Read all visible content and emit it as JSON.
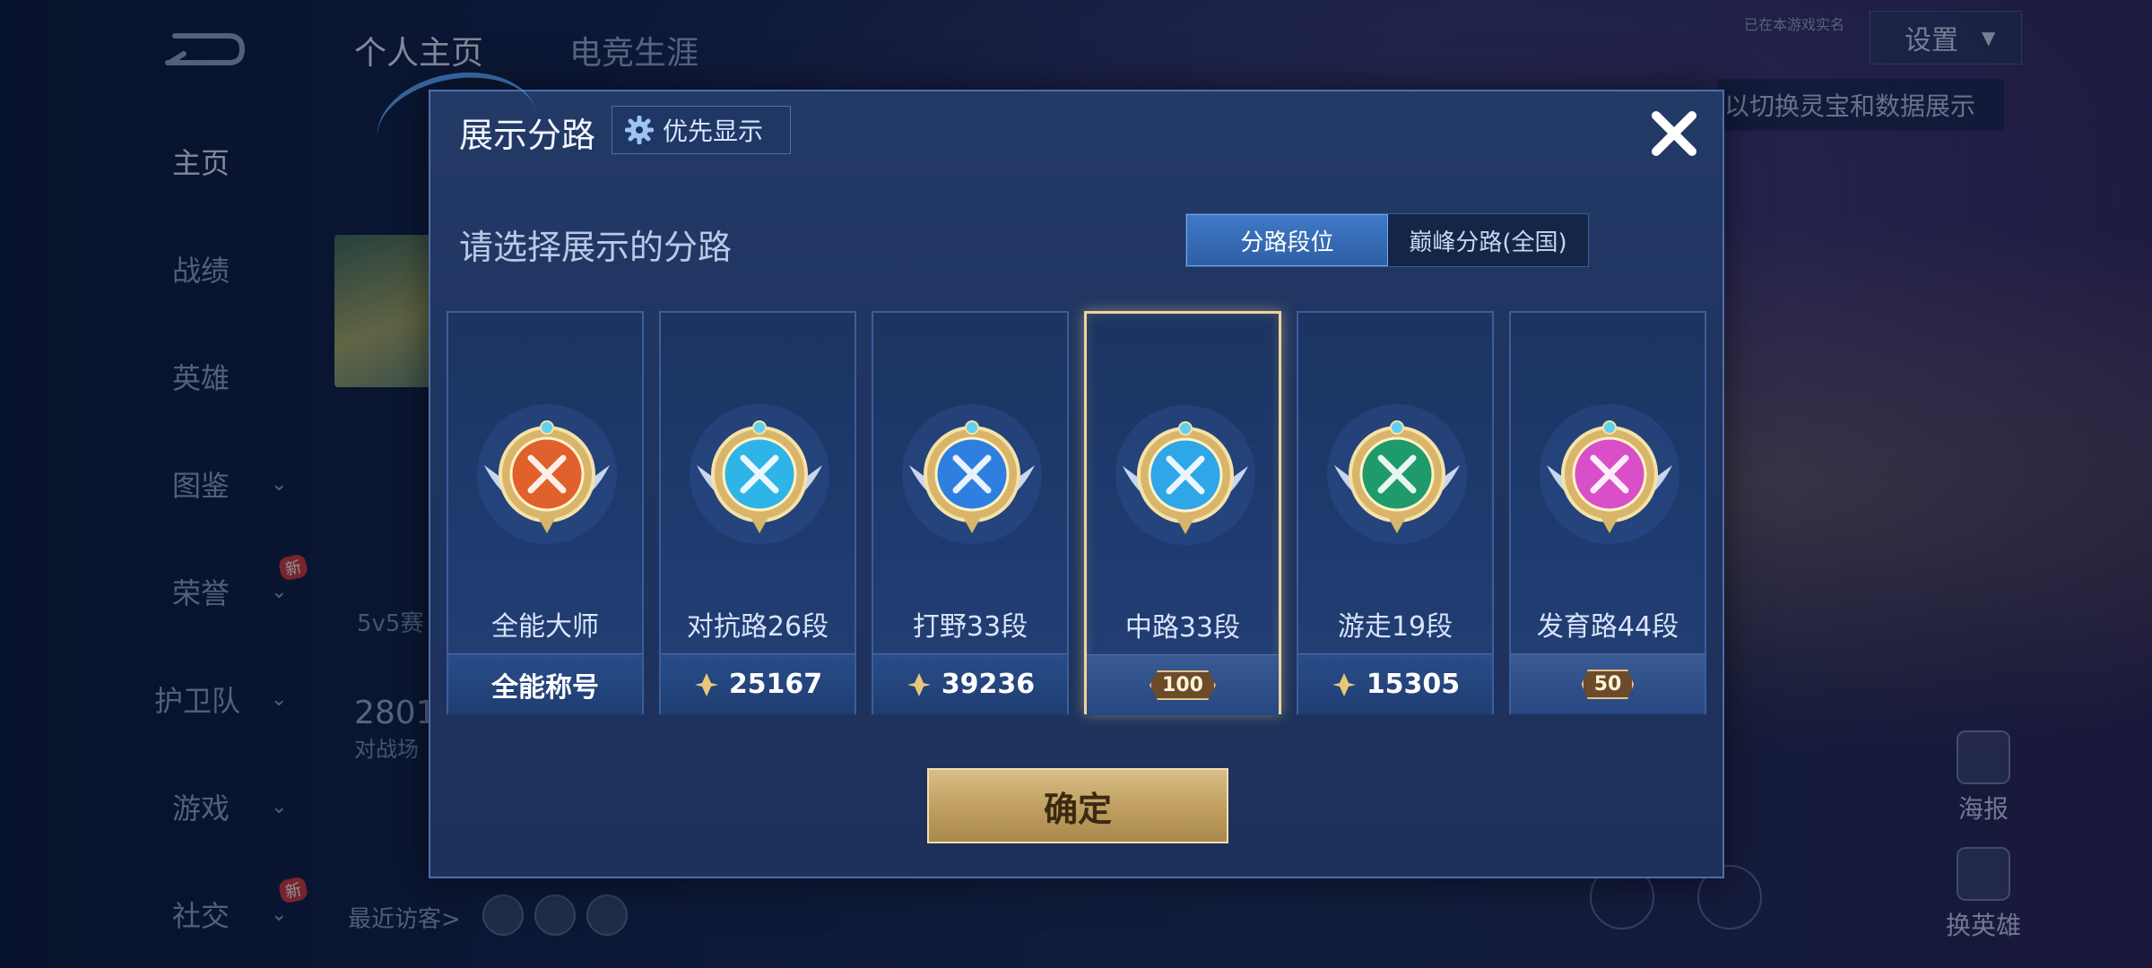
{
  "background": {
    "top_tabs": [
      "个人主页",
      "电竞生涯"
    ],
    "sidebar": [
      {
        "label": "主页",
        "active": true,
        "chevron": false
      },
      {
        "label": "战绩",
        "active": false,
        "chevron": false
      },
      {
        "label": "英雄",
        "active": false,
        "chevron": false
      },
      {
        "label": "图鉴",
        "active": false,
        "chevron": true
      },
      {
        "label": "荣誉",
        "active": false,
        "chevron": true,
        "new": "新"
      },
      {
        "label": "护卫队",
        "active": false,
        "chevron": true
      },
      {
        "label": "游戏",
        "active": false,
        "chevron": true
      },
      {
        "label": "社交",
        "active": false,
        "chevron": true,
        "new": "新"
      }
    ],
    "settings_label": "设置",
    "realname_tag": "已在本游戏实名",
    "hint_text": "以切换灵宝和数据展示",
    "poster_label": "海报",
    "switch_hero_label": "换英雄",
    "stat_number": "2801",
    "stat_sub": "对战场",
    "mode_text": "5v5赛",
    "visitors_label": "最近访客>"
  },
  "modal": {
    "title": "展示分路",
    "priority_label": "优先显示",
    "subtitle": "请选择展示的分路",
    "segments": [
      {
        "label": "分路段位",
        "active": true
      },
      {
        "label": "巅峰分路(全国)",
        "active": false
      }
    ],
    "confirm_label": "确定",
    "cards": [
      {
        "name": "全能大师",
        "bottom_text": "全能称号",
        "score": null,
        "ribbon": null,
        "selected": false,
        "badge_color": "#e0612b",
        "icon": "all-round-master-icon"
      },
      {
        "name": "对抗路26段",
        "bottom_text": null,
        "score": "25167",
        "ribbon": null,
        "selected": false,
        "badge_color": "#2fb4e8",
        "icon": "clash-lane-icon"
      },
      {
        "name": "打野33段",
        "bottom_text": null,
        "score": "39236",
        "ribbon": null,
        "selected": false,
        "badge_color": "#2f7fe0",
        "icon": "jungle-icon"
      },
      {
        "name": "中路33段",
        "bottom_text": null,
        "score": null,
        "ribbon": "100",
        "selected": true,
        "badge_color": "#2fa6e8",
        "icon": "mid-lane-icon"
      },
      {
        "name": "游走19段",
        "bottom_text": null,
        "score": "15305",
        "ribbon": null,
        "selected": false,
        "badge_color": "#1f9a6a",
        "icon": "roam-icon"
      },
      {
        "name": "发育路44段",
        "bottom_text": null,
        "score": null,
        "ribbon": "50",
        "selected": false,
        "badge_color": "#d84fc8",
        "icon": "farm-lane-icon"
      }
    ]
  }
}
